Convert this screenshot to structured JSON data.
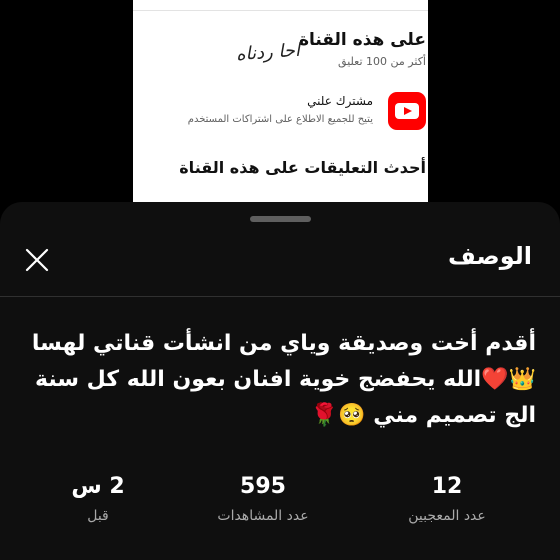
{
  "preview": {
    "heading": "على هذه القناة",
    "subheading": "أكثر من 100 تعليق",
    "handwriting": "احا ردناه",
    "subscription_title": "مشترك علني",
    "subscription_desc": "يتيح للجميع الاطلاع على اشتراكات المستخدم",
    "comments_heading": "أحدث التعليقات على هذه القناة",
    "icon": "youtube-icon",
    "accent_color": "#ff0000"
  },
  "sheet": {
    "title": "الوصف",
    "close_icon": "close-icon"
  },
  "description": {
    "line1": "أقدم أخت وصديقة وياي من انشأت قناتي لهسا",
    "line2": "👑❤️الله يحفضج خوية افنان بعون الله كل سنة",
    "line3": "الج تصميم مني 🥺🌹"
  },
  "stats": {
    "likes": {
      "value": "12",
      "label": "عدد المعجبين"
    },
    "views": {
      "value": "595",
      "label": "عدد المشاهدات"
    },
    "age": {
      "value": "2 س",
      "label": "قبل"
    }
  }
}
